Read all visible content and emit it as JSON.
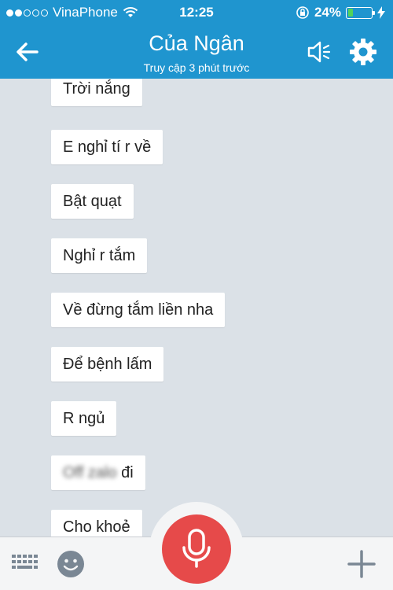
{
  "status_bar": {
    "carrier": "VinaPhone",
    "time": "12:25",
    "battery_percent": "24%",
    "battery_level": 0.24,
    "signal_full_dots": 2,
    "signal_total_dots": 5
  },
  "header": {
    "title": "Của Ngân",
    "subtitle": "Truy cập 3 phút trước"
  },
  "messages": [
    {
      "text": "Trời nắng"
    },
    {
      "text": "E nghỉ tí r về"
    },
    {
      "text": "Bật quạt"
    },
    {
      "text": "Nghỉ r tắm"
    },
    {
      "text": "Về đừng tắm liền nha"
    },
    {
      "text": "Để bệnh lấm"
    },
    {
      "text": "R ngủ"
    },
    {
      "text_blurred": "Off zalo",
      "text": "đi"
    },
    {
      "text": "Cho khoẻ"
    }
  ],
  "colors": {
    "header": "#1f95cf",
    "chat_background": "#dbe1e7",
    "mic": "#e64a4a",
    "battery": "#52d35a"
  },
  "icons": [
    "back-arrow-icon",
    "speaker-icon",
    "gear-icon",
    "keyboard-icon",
    "emoji-icon",
    "microphone-icon",
    "plus-icon"
  ]
}
